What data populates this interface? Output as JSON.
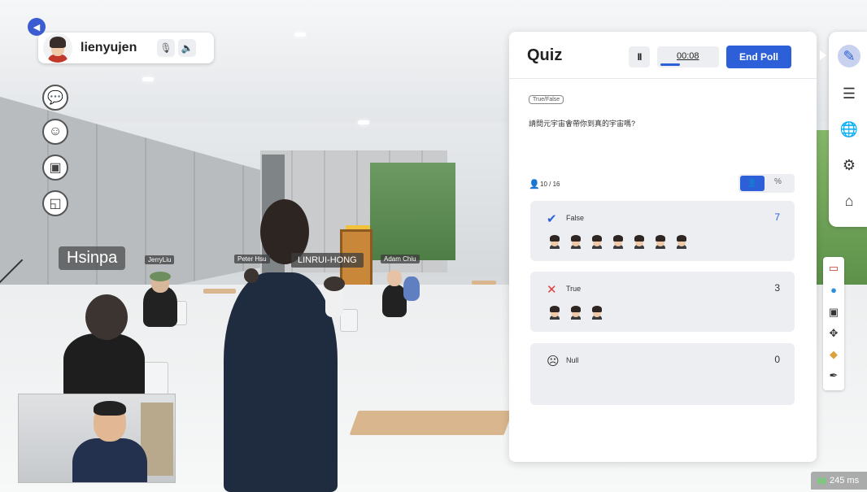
{
  "user": {
    "name": "lienyujen"
  },
  "scene": {
    "name_tags": [
      "Hsinpa",
      "JerryLiu",
      "Peter Hsu",
      "LINRUI-HONG",
      "Adam Chiu"
    ]
  },
  "quiz": {
    "title": "Quiz",
    "pause_label": "II",
    "timer": "00:08",
    "timer_progress": 0.35,
    "end_button": "End Poll",
    "question_type": "True/False",
    "question": "請問元宇宙會帶你到真的宇宙嗎?",
    "responses": "10 / 16",
    "toggle_percent": "%",
    "answers": [
      {
        "label": "False",
        "count": "7",
        "icon": "check-circle-icon",
        "avatars": 7
      },
      {
        "label": "True",
        "count": "3",
        "icon": "x-icon",
        "avatars": 3
      },
      {
        "label": "Null",
        "count": "0",
        "icon": "sad-face-icon",
        "avatars": 0
      }
    ]
  },
  "status": {
    "latency": "245 ms"
  },
  "colors": {
    "accent": "#2c5fd8",
    "false_count": "#2c5fd8",
    "true_icon": "#e23b3b"
  }
}
